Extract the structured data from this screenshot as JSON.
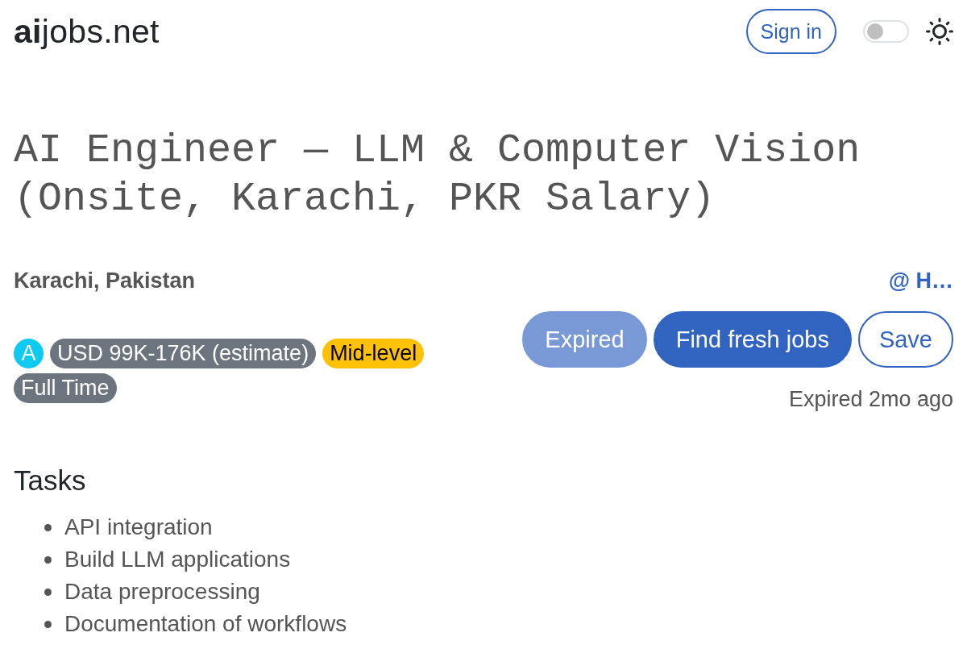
{
  "header": {
    "logo": "**ai**jobs.net",
    "sign_in_button": "Sign in",
    "theme_toggle": {
      "on": false
    }
  },
  "job": {
    "title": "AI Engineer — LLM & Computer Vision (Onsite, Karachi, PKR Salary)",
    "location": "Karachi, Pakistan",
    "company_link": "@ H…",
    "badges": [
      {
        "label": "A",
        "color": "#0dcaf0"
      },
      {
        "label": "USD 99K-176K (estimate)",
        "color": "#6c757d"
      },
      {
        "label": "Mid-level",
        "color": "#ffc107"
      },
      {
        "label": "Full Time",
        "color": "#6c757d"
      }
    ],
    "buttons": [
      {
        "label": "Expired",
        "kind": "primary",
        "disabled": true
      },
      {
        "label": "Find fresh jobs",
        "kind": "primary",
        "disabled": false
      },
      {
        "label": "Save",
        "kind": "outline",
        "disabled": false
      }
    ],
    "expiry_note": "Expired 2mo ago"
  },
  "tasks": {
    "heading": "Tasks",
    "items": [
      "API integration",
      "Build LLM applications",
      "Data preprocessing",
      "Documentation of workflows"
    ]
  }
}
